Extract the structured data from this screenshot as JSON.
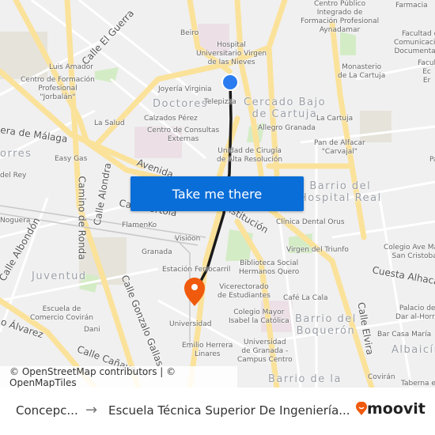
{
  "map": {
    "labels": {
      "beiro": "Beiro",
      "hospital": "Hospital\nUniversitario Virgen\nde las Nieves",
      "luis_amador": "Luis Amador",
      "centro_formacion": "Centro de Formación\nProfesional\n\"Jorbalán\"",
      "joyeria": "Joyería Virginia",
      "doctores": "Doctores",
      "telepizza": "Telepizza",
      "la_salud": "La Salud",
      "calzados": "Calzados Pérez",
      "consultas": "Centro de Consultas\nExternas",
      "easy_gas": "Easy Gas",
      "del_rey": "del Rey",
      "torres": "orres",
      "cepi": "Centro Público\nIntegrado de\nFormación Profesional\nAynadamar",
      "farmacia": "Farmacia",
      "facultad_com": "Facultad de\nComunicación y\nDocumentación",
      "facultad_ec": "Facul\nEc\nEr",
      "monasterio": "Monasterio\nde La Cartuja",
      "cercado": "Cercado Bajo\nde Cartuja",
      "la_cartuja": "La Cartuja",
      "allegro": "Allegro Granada",
      "pan_alfacar": "Pan de Alfacar\n\"Carvajal\"",
      "unidad_cirugia": "Unidad de Cirugía\nde Alta Resolución",
      "hospital_real": "Barrio del\nHospital Real",
      "noguera": "Noguera",
      "flamenko": "FlamenKo",
      "visioon": "Visióon",
      "granada": "Granada",
      "estacion": "Estación Ferrocarril",
      "juventud": "Juventud",
      "escuela_comercio": "Escuela de\nComercio Covirán",
      "dani": "Dani",
      "universidad": "Universidad",
      "emilio": "Emilio Herrera\nLinares",
      "clinica_orus": "Clínica Dental Orus",
      "virgen_triunfo": "Virgen del Triunfo",
      "biblioteca": "Biblioteca Social\nHermanos Quero",
      "vicerrectorado": "Vicerectorado\nde Estudiantes",
      "cafe_cala": "Café La Cala",
      "colegio_mayor": "Colegio Mayor\nIsabel la Católica",
      "boqueron": "Barrio del\nBoquerón",
      "ugr_centro": "Universidad\nde Granada -\nCampus Centro",
      "barrio_de_la": "Barrio de la",
      "colegio_ave": "Colegio Ave María\nSan Cristobal",
      "palacio": "Palacio de\nDar al-Horra",
      "bar_casa": "Bar Casa María",
      "albaicin": "Albaicín",
      "coviran": "Covirán",
      "taberna": "Taberna el",
      "calle_guerra": "Calle El Guerra",
      "carretera_malaga": "era de Málaga",
      "camino_ronda": "Camino de Ronda",
      "calle_alondra": "Calle Alondra",
      "avenida": "Avenida",
      "constitucion": "Constitución",
      "calle_tortola": "Calle Tórtola",
      "albondon": "Calle Albondón",
      "alvarez": "o Álvarez",
      "gonzalo_gallas": "Calle Gonzalo Gallas",
      "calle_canaveral": "Calle Cañaveral",
      "cuesta_alhacaba": "Cuesta Alhacaba",
      "calle_elvira": "Calle Elvira",
      "pa": "Pa"
    },
    "take_me_there": "Take me there",
    "attribution": "© OpenStreetMap contributors | © OpenMapTiles",
    "colors": {
      "route": "#1a1a1a",
      "origin": "#2b7cf0",
      "destination": "#f05a0c",
      "button": "#0a6ed8",
      "road": "#fbe7a0"
    }
  },
  "footer": {
    "from": "Concepc...",
    "arrow": "→",
    "to": "Escuela Técnica Superior De Ingeniería...",
    "brand": "moovit"
  }
}
